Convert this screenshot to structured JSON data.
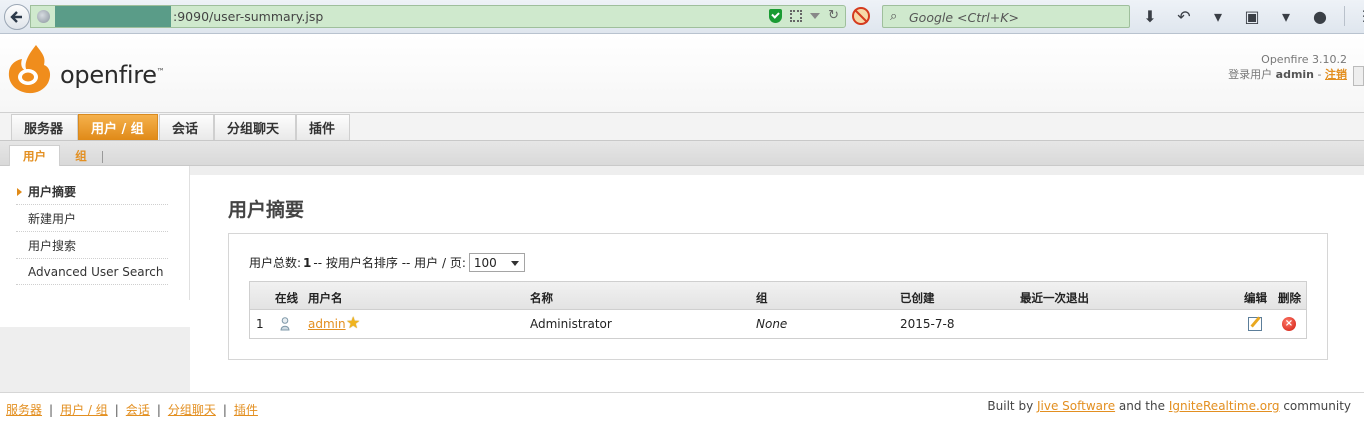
{
  "browser": {
    "url": ":9090/user-summary.jsp",
    "search_placeholder": "Google <Ctrl+K>"
  },
  "header": {
    "logo_text": "openfire",
    "logo_tm": "™",
    "version": "Openfire 3.10.2",
    "login_label": "登录用户",
    "login_user": "admin",
    "logout_label": "注销"
  },
  "main_tabs": [
    {
      "label": "服务器"
    },
    {
      "label": "用户 / 组"
    },
    {
      "label": "会话"
    },
    {
      "label": "分组聊天"
    },
    {
      "label": "插件"
    }
  ],
  "sub_tabs": [
    {
      "label": "用户"
    },
    {
      "label": "组"
    }
  ],
  "sidebar": {
    "items": [
      {
        "label": "用户摘要"
      },
      {
        "label": "新建用户"
      },
      {
        "label": "用户搜索"
      },
      {
        "label": "Advanced User Search"
      }
    ]
  },
  "main": {
    "title": "用户摘要",
    "summary_prefix": "用户总数:",
    "total_users": "1",
    "summary_middle": "-- 按用户名排序 -- 用户 / 页:",
    "per_page": "100",
    "columns": [
      "在线",
      "用户名",
      "名称",
      "组",
      "已创建",
      "最近一次退出",
      "编辑",
      "删除"
    ],
    "rows": [
      {
        "index": "1",
        "username": "admin",
        "name": "Administrator",
        "group": "None",
        "created": "2015-7-8",
        "last_logout": ""
      }
    ]
  },
  "footer": {
    "links": [
      "服务器",
      "用户 / 组",
      "会话",
      "分组聊天",
      "插件"
    ],
    "built_by": "Built by",
    "jive": "Jive Software",
    "and_the": "and the",
    "ignite": "IgniteRealtime.org",
    "community": "community"
  },
  "colors": {
    "accent": "#e38f20",
    "active_tab": "#e08a18",
    "url_bar": "#cfe9cd"
  }
}
